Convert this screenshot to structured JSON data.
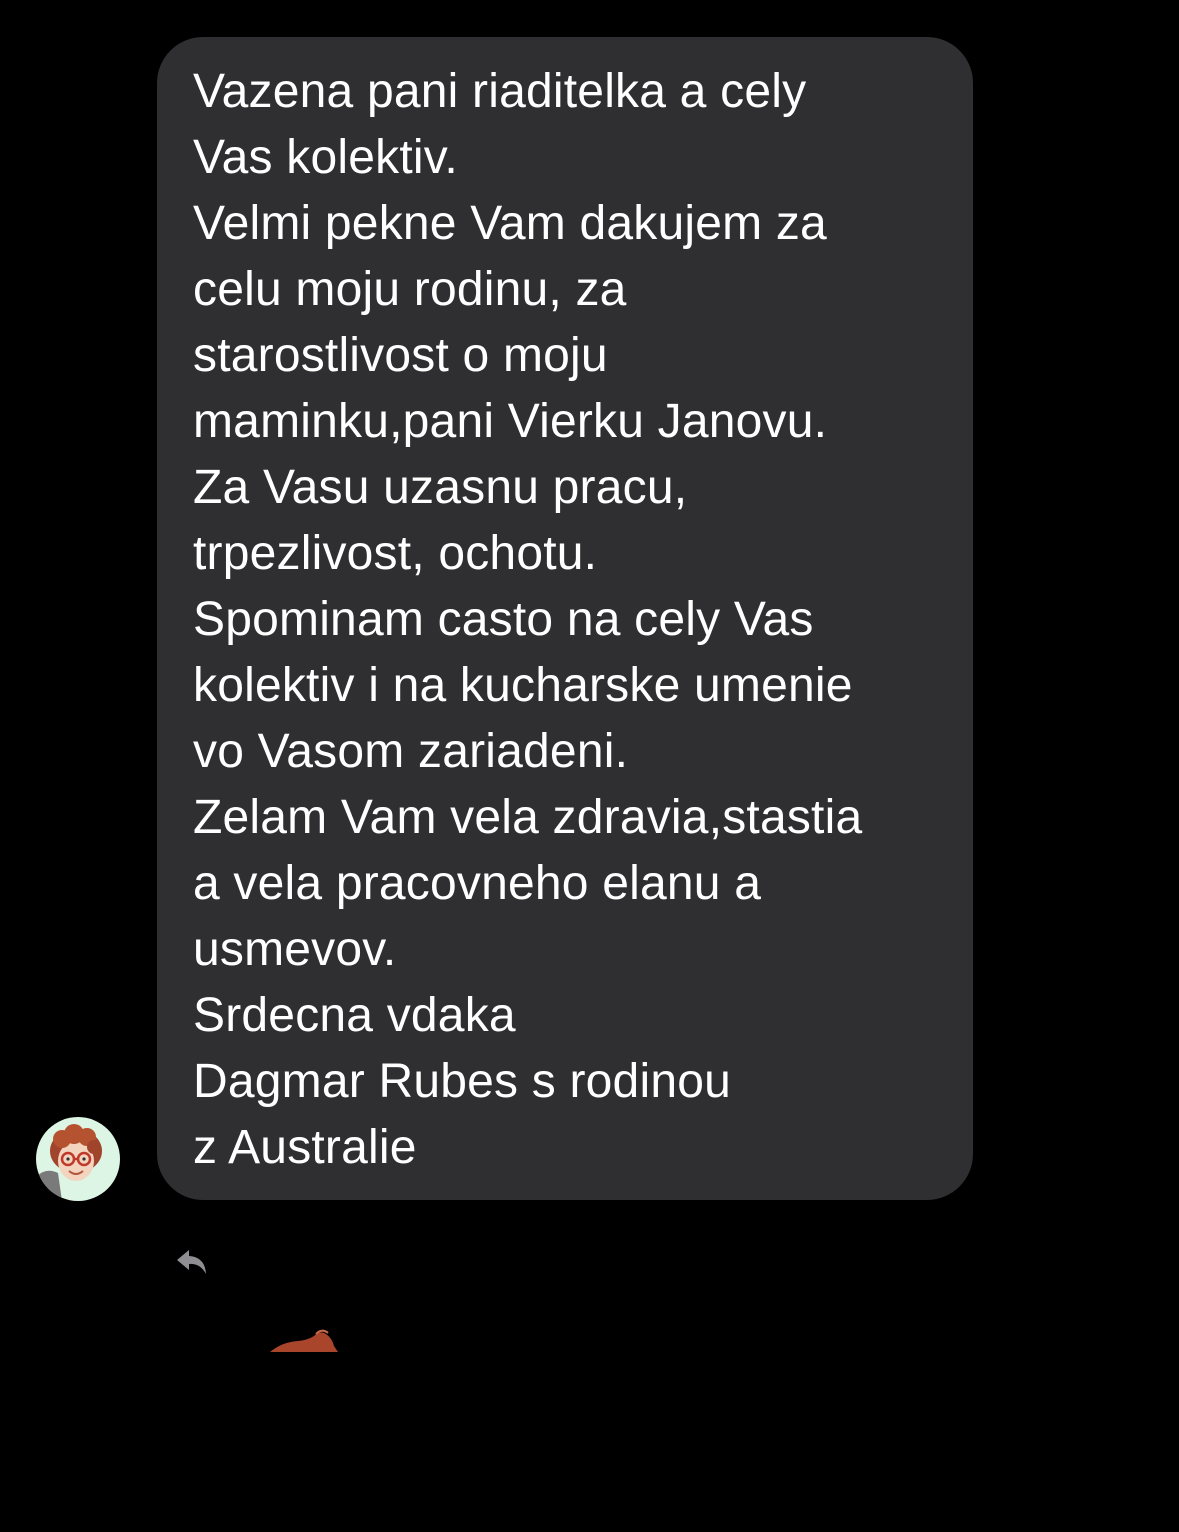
{
  "conversation": {
    "message": {
      "lines": [
        "Vazena pani riaditelka a cely",
        "Vas kolektiv.",
        "Velmi pekne Vam dakujem za",
        "celu moju rodinu, za",
        "starostlivost o moju",
        "maminku,pani Vierku Janovu.",
        "Za Vasu uzasnu pracu,",
        "trpezlivost, ochotu.",
        "Spominam casto na cely Vas",
        "kolektiv i na kucharske umenie",
        "vo Vasom zariadeni.",
        "Zelam Vam vela zdravia,stastia",
        "a vela pracovneho elanu a",
        "usmevov.",
        "Srdecna vdaka",
        "Dagmar Rubes s rodinou",
        "z Australie"
      ]
    },
    "sender": {
      "avatar_icon": "cartoon-avatar-icon"
    },
    "actions": {
      "reply_icon": "reply-arrow-icon"
    }
  },
  "colors": {
    "background": "#000000",
    "bubble": "#2f2f31",
    "text": "#ffffff",
    "avatar_bg": "#dcf5e4",
    "icon_gray": "#8e8e93"
  }
}
